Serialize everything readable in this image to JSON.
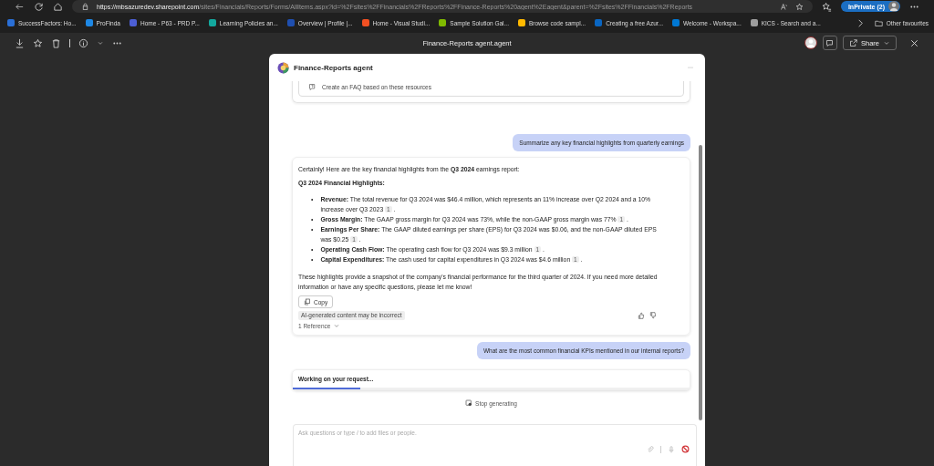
{
  "browser": {
    "url_host": "https://mbsazuredev.sharepoint.com",
    "url_path": "/sites/Financials/Reports/Forms/AllItems.aspx?id=%2Fsites%2FFinancials%2FReports%2FFinance-Reports%20agent%2Eagent&parent=%2Fsites%2FFinancials%2FReports",
    "profile_label": "InPrivate (2)",
    "bookmarks": [
      {
        "label": "SuccessFactors: Ho...",
        "color": "#2a6fd6"
      },
      {
        "label": "ProFinda",
        "color": "#1e88e5"
      },
      {
        "label": "Home - P63 - PRD P...",
        "color": "#4c5fd5"
      },
      {
        "label": "Learning Policies an...",
        "color": "#13a89e"
      },
      {
        "label": "Overview | Profile |...",
        "color": "#1f4fb0"
      },
      {
        "label": "Home - Visual Studi...",
        "color": "#f25022"
      },
      {
        "label": "Sample Solution Gal...",
        "color": "#7fba00"
      },
      {
        "label": "Browse code sampl...",
        "color": "#ffb900"
      },
      {
        "label": "Creating a free Azur...",
        "color": "#0a66c2"
      },
      {
        "label": "Welcome - Workspa...",
        "color": "#0078d4"
      },
      {
        "label": "KICS - Search and a...",
        "color": "#9e9e9e"
      }
    ],
    "other_favourites": "Other favourites"
  },
  "viewer": {
    "title": "Finance-Reports agent.agent",
    "share": "Share"
  },
  "dialog": {
    "title": "Finance-Reports agent",
    "suggestion": "Create an FAQ based on these resources",
    "messages": [
      {
        "kind": "user",
        "text": "Summarize any key financial highlights from quarterly earnings"
      },
      {
        "kind": "assistant",
        "intro": "Certainly! Here are the key financial highlights from the **Q3 2024** earnings report:",
        "heading": "Q3 2024 Financial Highlights:",
        "bullets": [
          {
            "term": "Revenue:",
            "text": "The total revenue for Q3 2024 was $46.4 million, which represents an 11% increase over Q2 2024 and a 10% increase over Q3 2023",
            "citation": "1",
            "marker": "•",
            "end": "."
          },
          {
            "term": "Gross Margin:",
            "text": "The GAAP gross margin for Q3 2024 was 73%, while the non-GAAP gross margin was 77%",
            "citation": "1",
            "marker": "•",
            "end": "."
          },
          {
            "term": "Earnings Per Share:",
            "text": "The GAAP diluted earnings per share (EPS) for Q3 2024 was $0.06, and the non-GAAP diluted EPS was $0.25",
            "citation": "1",
            "marker": "•",
            "end": "."
          },
          {
            "term": "Operating Cash Flow:",
            "text": "The operating cash flow for Q3 2024 was $9.3 million",
            "citation": "1",
            "marker": "•",
            "end": "."
          },
          {
            "term": "Capital Expenditures:",
            "text": "The cash used for capital expenditures in Q3 2024 was $4.6 million",
            "citation": "1",
            "marker": "•",
            "end": "."
          }
        ],
        "closing": "These highlights provide a snapshot of the company's financial performance for the third quarter of 2024. If you need more detailed information or have any specific questions, please let me know!",
        "copy": "Copy",
        "disclaimer": "AI-generated content may be incorrect",
        "references": "1 Reference"
      },
      {
        "kind": "user",
        "text": "What are the most common financial KPIs mentioned in our internal reports?"
      },
      {
        "kind": "working",
        "text": "Working on your request...",
        "level": 0.17
      }
    ],
    "stop": "Stop generating",
    "placeholder": "Ask questions or type / to add files or people."
  }
}
